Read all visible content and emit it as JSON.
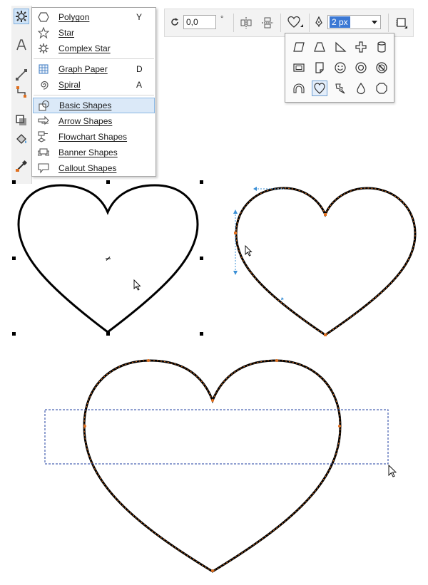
{
  "menu": {
    "items": [
      {
        "label": "Polygon",
        "shortcut": "Y",
        "icon": "polygon-icon"
      },
      {
        "label": "Star",
        "shortcut": "",
        "icon": "star-icon"
      },
      {
        "label": "Complex Star",
        "shortcut": "",
        "icon": "complex-star-icon"
      },
      {
        "label": "Graph Paper",
        "shortcut": "D",
        "icon": "graph-paper-icon"
      },
      {
        "label": "Spiral",
        "shortcut": "A",
        "icon": "spiral-icon"
      },
      {
        "label": "Basic Shapes",
        "shortcut": "",
        "icon": "basic-shapes-icon",
        "selected": true
      },
      {
        "label": "Arrow Shapes",
        "shortcut": "",
        "icon": "arrow-shapes-icon"
      },
      {
        "label": "Flowchart Shapes",
        "shortcut": "",
        "icon": "flowchart-shapes-icon"
      },
      {
        "label": "Banner Shapes",
        "shortcut": "",
        "icon": "banner-shapes-icon"
      },
      {
        "label": "Callout Shapes",
        "shortcut": "",
        "icon": "callout-shapes-icon"
      }
    ]
  },
  "propbar": {
    "angle_value": "0,0",
    "angle_unit": "°",
    "outline_width": "2 px"
  },
  "picker": {
    "shapes": [
      "parallelogram-icon",
      "trapezoid-icon",
      "right-triangle-icon",
      "cross-icon",
      "cylinder-icon",
      "frame-icon",
      "folded-corner-icon",
      "smiley-icon",
      "donut-icon",
      "no-symbol-icon",
      "arc-icon",
      "heart-icon",
      "lightning-icon",
      "teardrop-icon",
      "octagon-icon"
    ],
    "selected": "heart-icon"
  },
  "colors": {
    "selection": "#dbe9f8",
    "highlight": "#3b78d4",
    "node_orange": "#e07020",
    "guide_blue": "#3a8fd6",
    "marquee": "#1f3fa0"
  }
}
